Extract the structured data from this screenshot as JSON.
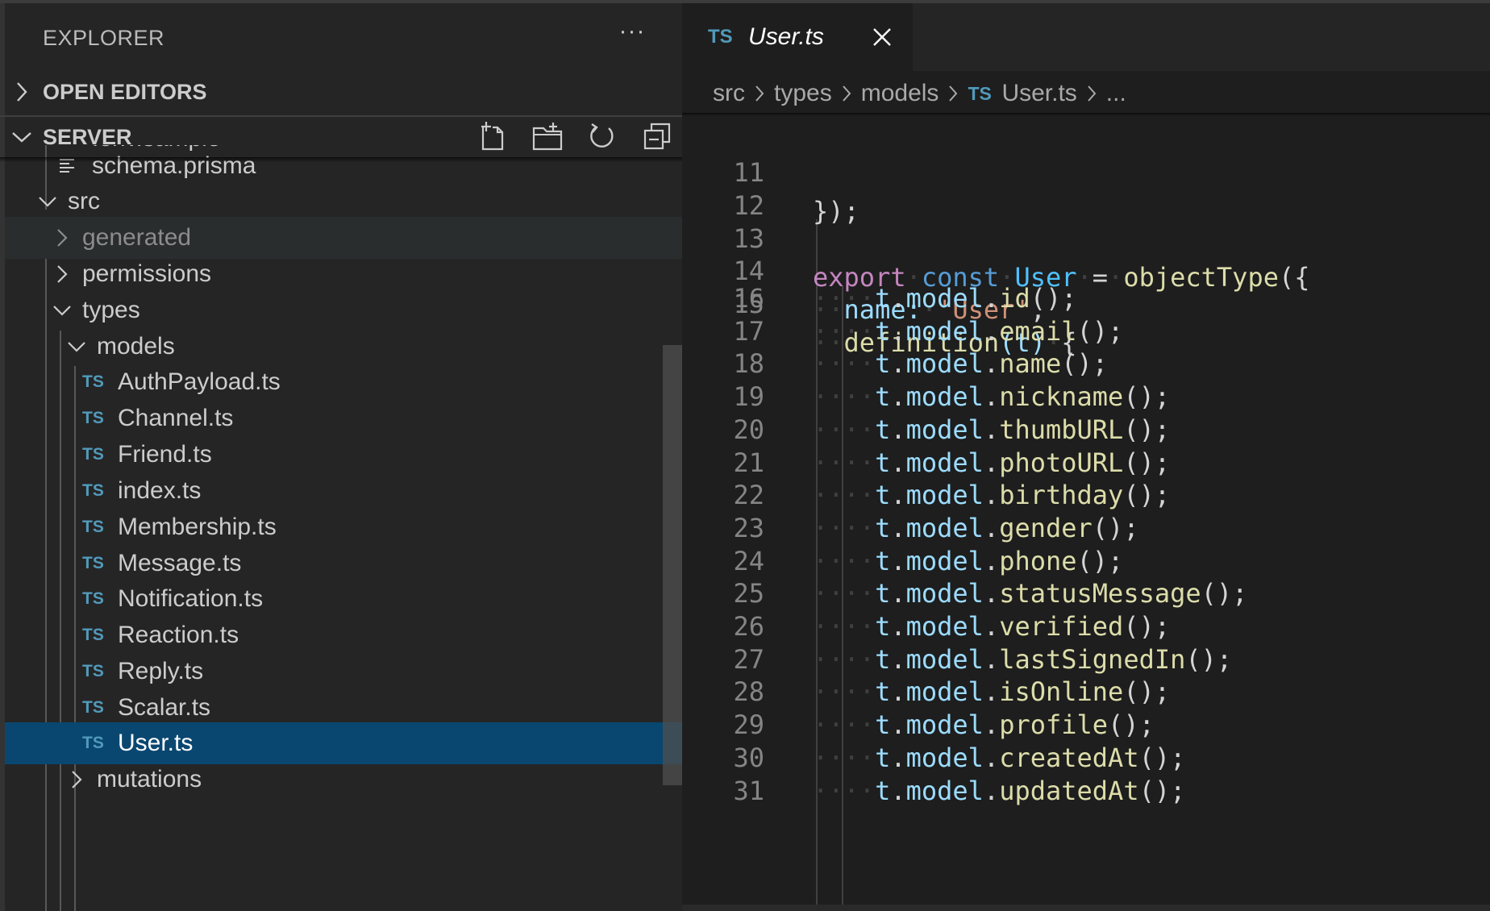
{
  "explorer": {
    "title": "EXPLORER",
    "more_label": "···",
    "sections": {
      "open_editors": "OPEN EDITORS",
      "server": "SERVER"
    },
    "toolbar": [
      "new-file-icon",
      "new-folder-icon",
      "refresh-icon",
      "collapse-all-icon"
    ],
    "tree": {
      "partial_top": ".env.sample",
      "schema": "schema.prisma",
      "src": "src",
      "generated": "generated",
      "permissions": "permissions",
      "types": "types",
      "models": "models",
      "files": [
        "AuthPayload.ts",
        "Channel.ts",
        "Friend.ts",
        "index.ts",
        "Membership.ts",
        "Message.ts",
        "Notification.ts",
        "Reaction.ts",
        "Reply.ts",
        "Scalar.ts",
        "User.ts"
      ],
      "partial_bottom": "mutations"
    },
    "ts_badge": "TS"
  },
  "editor": {
    "tab": {
      "badge": "TS",
      "title": "User.ts"
    },
    "breadcrumb": [
      "src",
      "types",
      "models",
      "User.ts",
      "..."
    ],
    "line_numbers": [
      "11",
      "12",
      "13",
      "14",
      "15",
      "16",
      "17",
      "18",
      "19",
      "20",
      "21",
      "22",
      "23",
      "24",
      "25",
      "26",
      "27",
      "28",
      "29",
      "30",
      "31"
    ],
    "model_fields": [
      "id",
      "email",
      "name",
      "nickname",
      "thumbURL",
      "photoURL",
      "birthday",
      "gender",
      "phone",
      "statusMessage",
      "verified",
      "lastSignedIn",
      "isOnline",
      "profile",
      "createdAt",
      "updatedAt"
    ],
    "code": {
      "line11": "});",
      "export_kw": "export",
      "const_kw": "const",
      "user_ident": "User",
      "equals": "=",
      "object_type": "objectType",
      "open_paren_brace": "({",
      "name_prop": "name:",
      "name_value": "'User'",
      "comma": ",",
      "definition": "definition",
      "t_param": "(t)",
      "open_brace": "{",
      "t": "t",
      "model": "model",
      "call_end": "();"
    }
  },
  "colors": {
    "sidebar_bg": "#252526",
    "editor_bg": "#1e1e1e",
    "selection": "#094771",
    "ts_badge": "#519aba",
    "keyword": "#c586c0",
    "storage": "#569cd6",
    "function": "#dcdcaa",
    "property": "#9cdcfe",
    "string": "#ce9178"
  }
}
